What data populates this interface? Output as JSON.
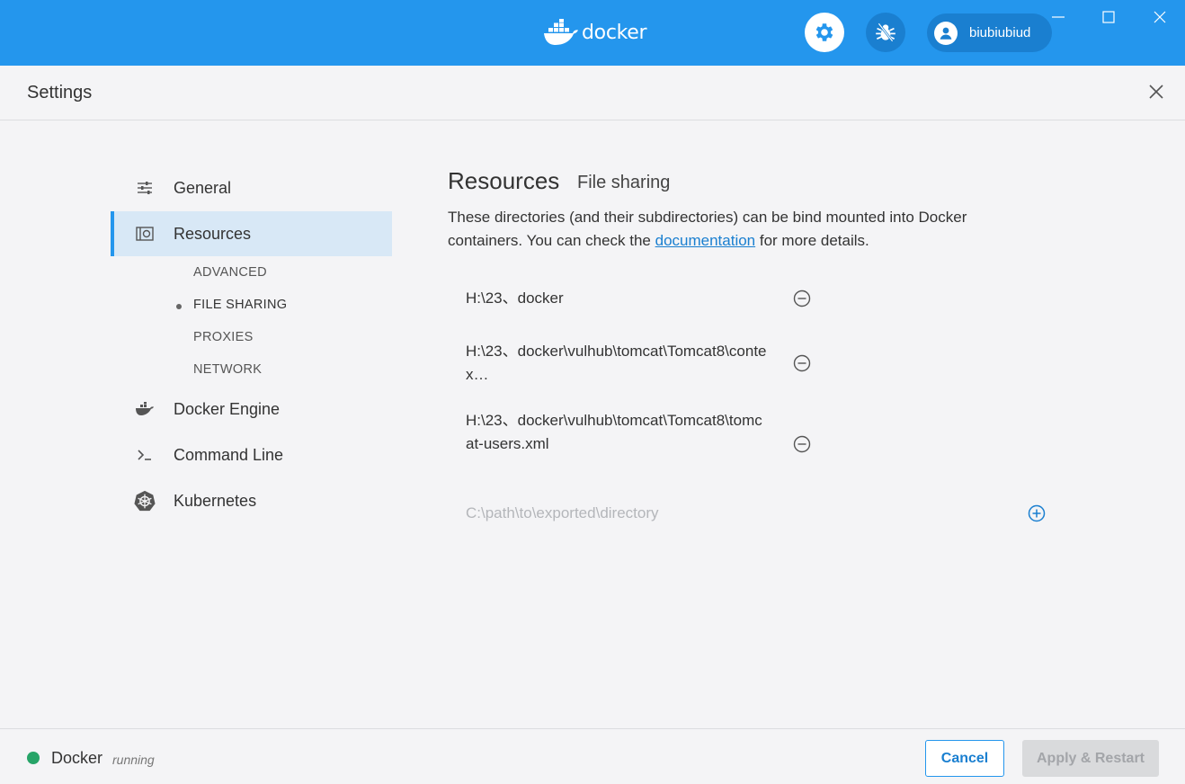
{
  "titlebar": {
    "brand": "docker",
    "user_name": "biubiubiud",
    "colors": {
      "bar": "#2496ed",
      "pill": "#1a7fd0"
    }
  },
  "settings": {
    "title": "Settings"
  },
  "sidebar": {
    "items": [
      {
        "label": "General",
        "icon": "sliders-icon"
      },
      {
        "label": "Resources",
        "icon": "resources-icon"
      },
      {
        "label": "Docker Engine",
        "icon": "whale-engine-icon"
      },
      {
        "label": "Command Line",
        "icon": "terminal-prompt-icon"
      },
      {
        "label": "Kubernetes",
        "icon": "kubernetes-helm-icon"
      }
    ],
    "resource_sub_items": [
      {
        "label": "ADVANCED"
      },
      {
        "label": "FILE SHARING"
      },
      {
        "label": "PROXIES"
      },
      {
        "label": "NETWORK"
      }
    ],
    "selected": "Resources",
    "selected_sub": "FILE SHARING"
  },
  "main": {
    "title": "Resources",
    "subtitle": "File sharing",
    "description_before": "These directories (and their subdirectories) can be bind mounted into Docker containers. You can check the ",
    "description_link": "documentation",
    "description_after": " for more details.",
    "shared_paths": [
      "H:\\23、docker",
      "H:\\23、docker\\vulhub\\tomcat\\Tomcat8\\contex…",
      "H:\\23、docker\\vulhub\\tomcat\\Tomcat8\\tomcat-users.xml"
    ],
    "new_path_placeholder": "C:\\path\\to\\exported\\directory",
    "new_path_value": ""
  },
  "footer": {
    "app_name": "Docker",
    "state": "running",
    "status_color": "#27a468",
    "cancel_label": "Cancel",
    "apply_label": "Apply & Restart"
  }
}
